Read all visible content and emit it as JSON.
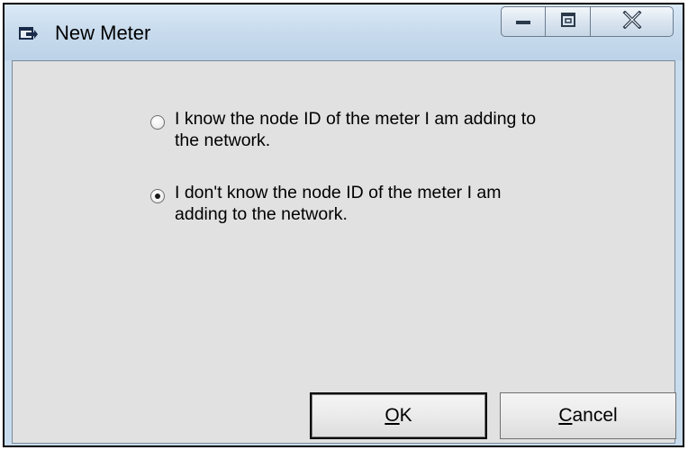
{
  "window": {
    "title": "New Meter"
  },
  "options": [
    {
      "line1": "I know the node ID of the meter I am adding to",
      "line2": "the network.",
      "selected": false
    },
    {
      "line1": "I don't know the node ID of the meter I am",
      "line2": "adding to the network.",
      "selected": true
    }
  ],
  "buttons": {
    "ok_mnemonic": "O",
    "ok_rest": "K",
    "cancel_mnemonic": "C",
    "cancel_rest": "ancel"
  },
  "icons": {
    "app": "window-app-icon",
    "minimize": "minimize-icon",
    "maximize": "maximize-icon",
    "close": "close-icon"
  }
}
